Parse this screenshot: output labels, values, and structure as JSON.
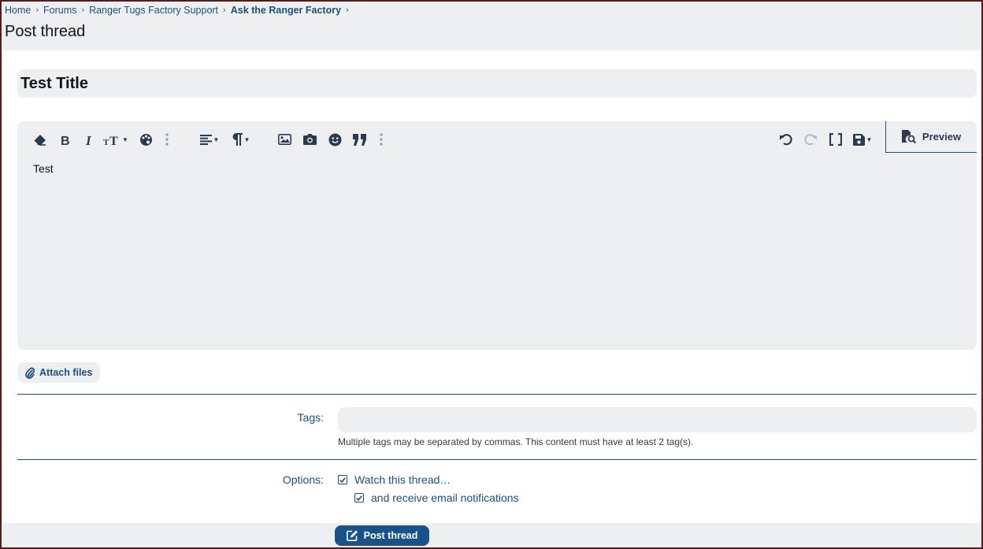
{
  "breadcrumb": {
    "items": [
      "Home",
      "Forums",
      "Ranger Tugs Factory Support",
      "Ask the Ranger Factory"
    ],
    "separator": "›"
  },
  "page_title": "Post thread",
  "form": {
    "title_value": "Test Title",
    "editor": {
      "body_text": "Test",
      "preview_label": "Preview",
      "toolbar": [
        "eraser-icon",
        "bold-icon",
        "italic-icon",
        "text-size-icon",
        "palette-icon",
        "more-icon",
        "align-icon",
        "paragraph-icon",
        "image-icon",
        "camera-icon",
        "smiley-icon",
        "quote-icon",
        "more-icon",
        "undo-icon",
        "redo-icon",
        "fullscreen-icon",
        "save-draft-icon"
      ]
    },
    "attach_label": "Attach files",
    "tags": {
      "label": "Tags:",
      "value": "",
      "hint": "Multiple tags may be separated by commas. This content must have at least 2 tag(s)."
    },
    "options": {
      "label": "Options:",
      "watch_label": "Watch this thread…",
      "watch_checked": true,
      "email_label": "and receive email notifications",
      "email_checked": true
    },
    "submit_label": "Post thread"
  },
  "colors": {
    "accent": "#1b4f7e",
    "button": "#185289",
    "surface": "#eeeff1",
    "frame": "#5a1a1a"
  }
}
